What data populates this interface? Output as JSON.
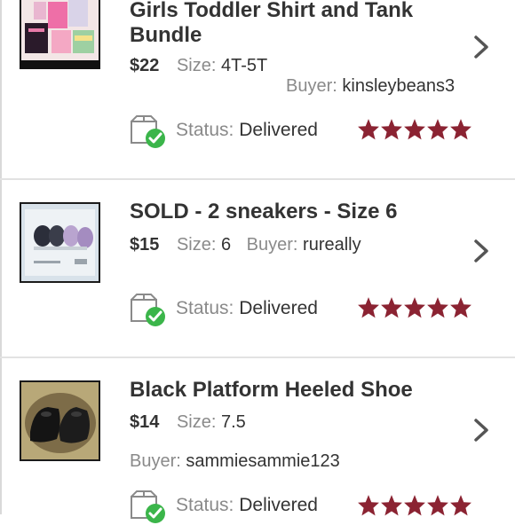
{
  "orders": [
    {
      "title": "Girls Toddler Shirt and Tank Bundle",
      "price": "$22",
      "size_label": "Size:",
      "size_value": "4T-5T",
      "buyer_label": "Buyer:",
      "buyer_value": "kinsleybeans3",
      "status_label": "Status:",
      "status_value": "Delivered",
      "rating": 5
    },
    {
      "title": "SOLD - 2 sneakers - Size 6",
      "price": "$15",
      "size_label": "Size:",
      "size_value": "6",
      "buyer_label": "Buyer:",
      "buyer_value": "rureally",
      "status_label": "Status:",
      "status_value": "Delivered",
      "rating": 5
    },
    {
      "title": "Black Platform Heeled Shoe",
      "price": "$14",
      "size_label": "Size:",
      "size_value": "7.5",
      "buyer_label": "Buyer:",
      "buyer_value": "sammiesammie123",
      "status_label": "Status:",
      "status_value": "Delivered",
      "rating": 5
    }
  ],
  "colors": {
    "star": "#8b2332",
    "check": "#3bb54a",
    "chevron": "#555555",
    "muted_text": "#8a8a8a"
  },
  "icons": [
    "chevron-right-icon",
    "delivered-package-icon",
    "star-icon"
  ]
}
